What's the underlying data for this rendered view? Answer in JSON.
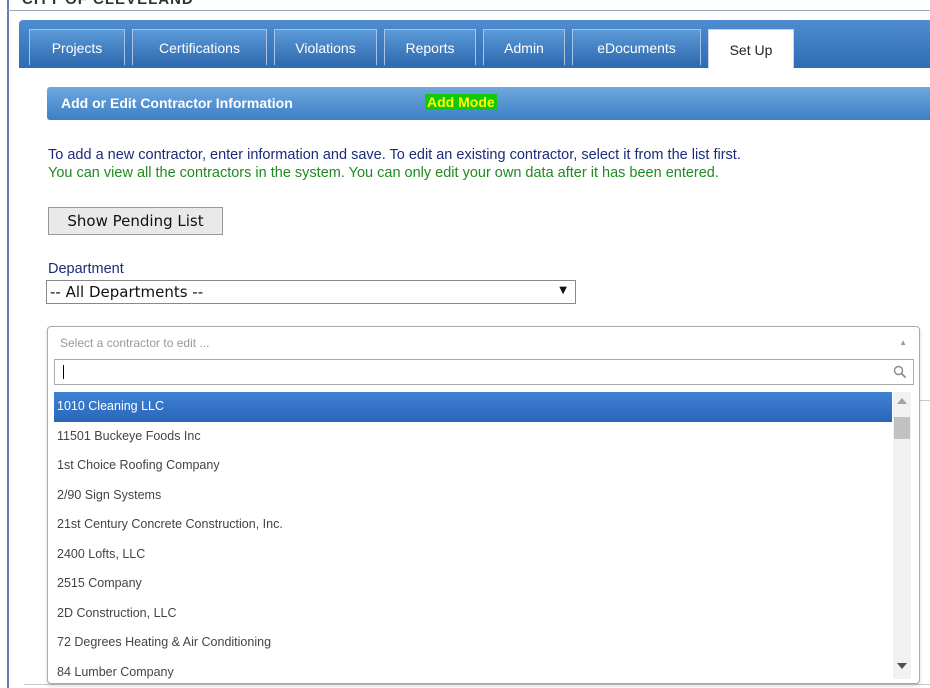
{
  "header_fragment": "CITY OF CLEVELAND",
  "tabs": [
    {
      "label": "Projects",
      "active": false
    },
    {
      "label": "Certifications",
      "active": false
    },
    {
      "label": "Violations",
      "active": false
    },
    {
      "label": "Reports",
      "active": false
    },
    {
      "label": "Admin",
      "active": false
    },
    {
      "label": "eDocuments",
      "active": false
    },
    {
      "label": "Set Up",
      "active": true
    }
  ],
  "section": {
    "title": "Add or Edit Contractor Information",
    "mode": "Add Mode"
  },
  "intro": {
    "line1": "To add a new contractor, enter information and save. To edit an existing contractor, select it from the list first.",
    "line2": "You can view all the contractors in the system. You can only edit your own data after it has been entered."
  },
  "pending_button_label": "Show Pending List",
  "department": {
    "label": "Department",
    "selected": "-- All Departments --"
  },
  "contractor_select": {
    "placeholder": "Select a contractor to edit ...",
    "search_value": "",
    "options": [
      "1010 Cleaning LLC",
      "11501 Buckeye Foods Inc",
      "1st Choice Roofing Company",
      "2/90 Sign Systems",
      "21st Century Concrete Construction, Inc.",
      "2400 Lofts, LLC",
      "2515 Company",
      "2D Construction, LLC",
      "72 Degrees Heating & Air Conditioning",
      "84 Lumber Company"
    ],
    "highlighted_index": 0
  },
  "icons": {
    "search": "search-icon",
    "dropdown": "chevron-down-icon",
    "collapse": "chevron-up-icon"
  },
  "colors": {
    "tabbar": "#2e6cb4",
    "section_header": "#3d7fc6",
    "mode_badge_bg": "#11c80b",
    "mode_badge_text": "#ffff00",
    "intro_blue": "#1a2c7a",
    "intro_green": "#1f8a1f",
    "highlight": "#2a66b7"
  }
}
